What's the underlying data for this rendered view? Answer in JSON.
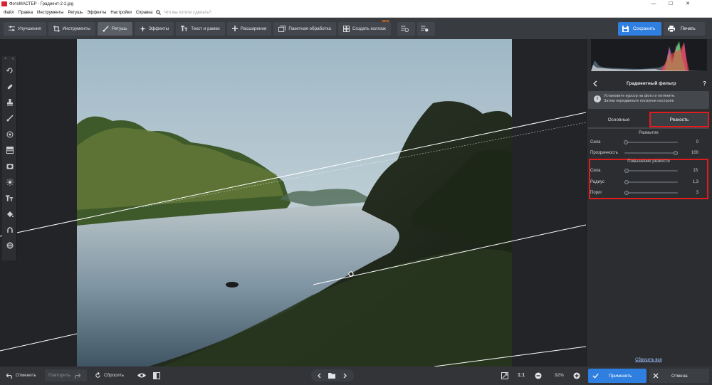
{
  "window": {
    "title": "ФотоМАСТЕР - Градиент-2-2.jpg",
    "controls": [
      "—",
      "☐",
      "✕"
    ]
  },
  "menu": {
    "items": [
      "Файл",
      "Правка",
      "Инструменты",
      "Ретушь",
      "Эффекты",
      "Настройки",
      "Справка"
    ],
    "search_placeholder": "Что вы хотите сделать?"
  },
  "toolbar": {
    "tabs": [
      {
        "label": "Улучшения",
        "icon": "sliders-icon"
      },
      {
        "label": "Инструменты",
        "icon": "crop-icon"
      },
      {
        "label": "Ретушь",
        "icon": "brush-icon",
        "active": true
      },
      {
        "label": "Эффекты",
        "icon": "sparkle-icon"
      },
      {
        "label": "Текст и рамки",
        "icon": "text-icon"
      },
      {
        "label": "Расширения",
        "icon": "plus-icon"
      },
      {
        "label": "Пакетная обработка",
        "icon": "batch-icon"
      },
      {
        "label": "Создать коллаж",
        "icon": "collage-icon",
        "badge": "NEW"
      }
    ],
    "save_label": "Сохранить",
    "print_label": "Печать"
  },
  "panel": {
    "title": "Градиентный фильтр",
    "help": "?",
    "hint_line1": "Установите курсор на фото и потяните.",
    "hint_line2": "Затем передвиньте ползунки настроек",
    "tabs": [
      "Основные",
      "Резкость"
    ],
    "active_tab": "Резкость",
    "blur_section": "Размытие",
    "blur_rows": [
      {
        "label": "Сила",
        "value": "0",
        "level": 0.0
      },
      {
        "label": "Прозрачность",
        "value": "100",
        "level": 1.0
      }
    ],
    "sharp_section": "Повышение резкости",
    "sharp_rows": [
      {
        "label": "Сила",
        "value": "15",
        "level": 0.02,
        "selected": true
      },
      {
        "label": "Радиус",
        "value": "1,3",
        "level": 0.02
      },
      {
        "label": "Порог",
        "value": "3",
        "level": 0.02
      }
    ],
    "reset_all": "Сбросить все"
  },
  "bottom": {
    "undo": "Отменить",
    "redo": "Повторить",
    "reset": "Сбросить",
    "ratio": "1:1",
    "zoom": "92%",
    "apply": "Применить",
    "cancel": "Отмена"
  },
  "colors": {
    "accent": "#2f7fe0",
    "highlight_frame": "#e11c1c",
    "panel_bg": "#2b2d30"
  }
}
